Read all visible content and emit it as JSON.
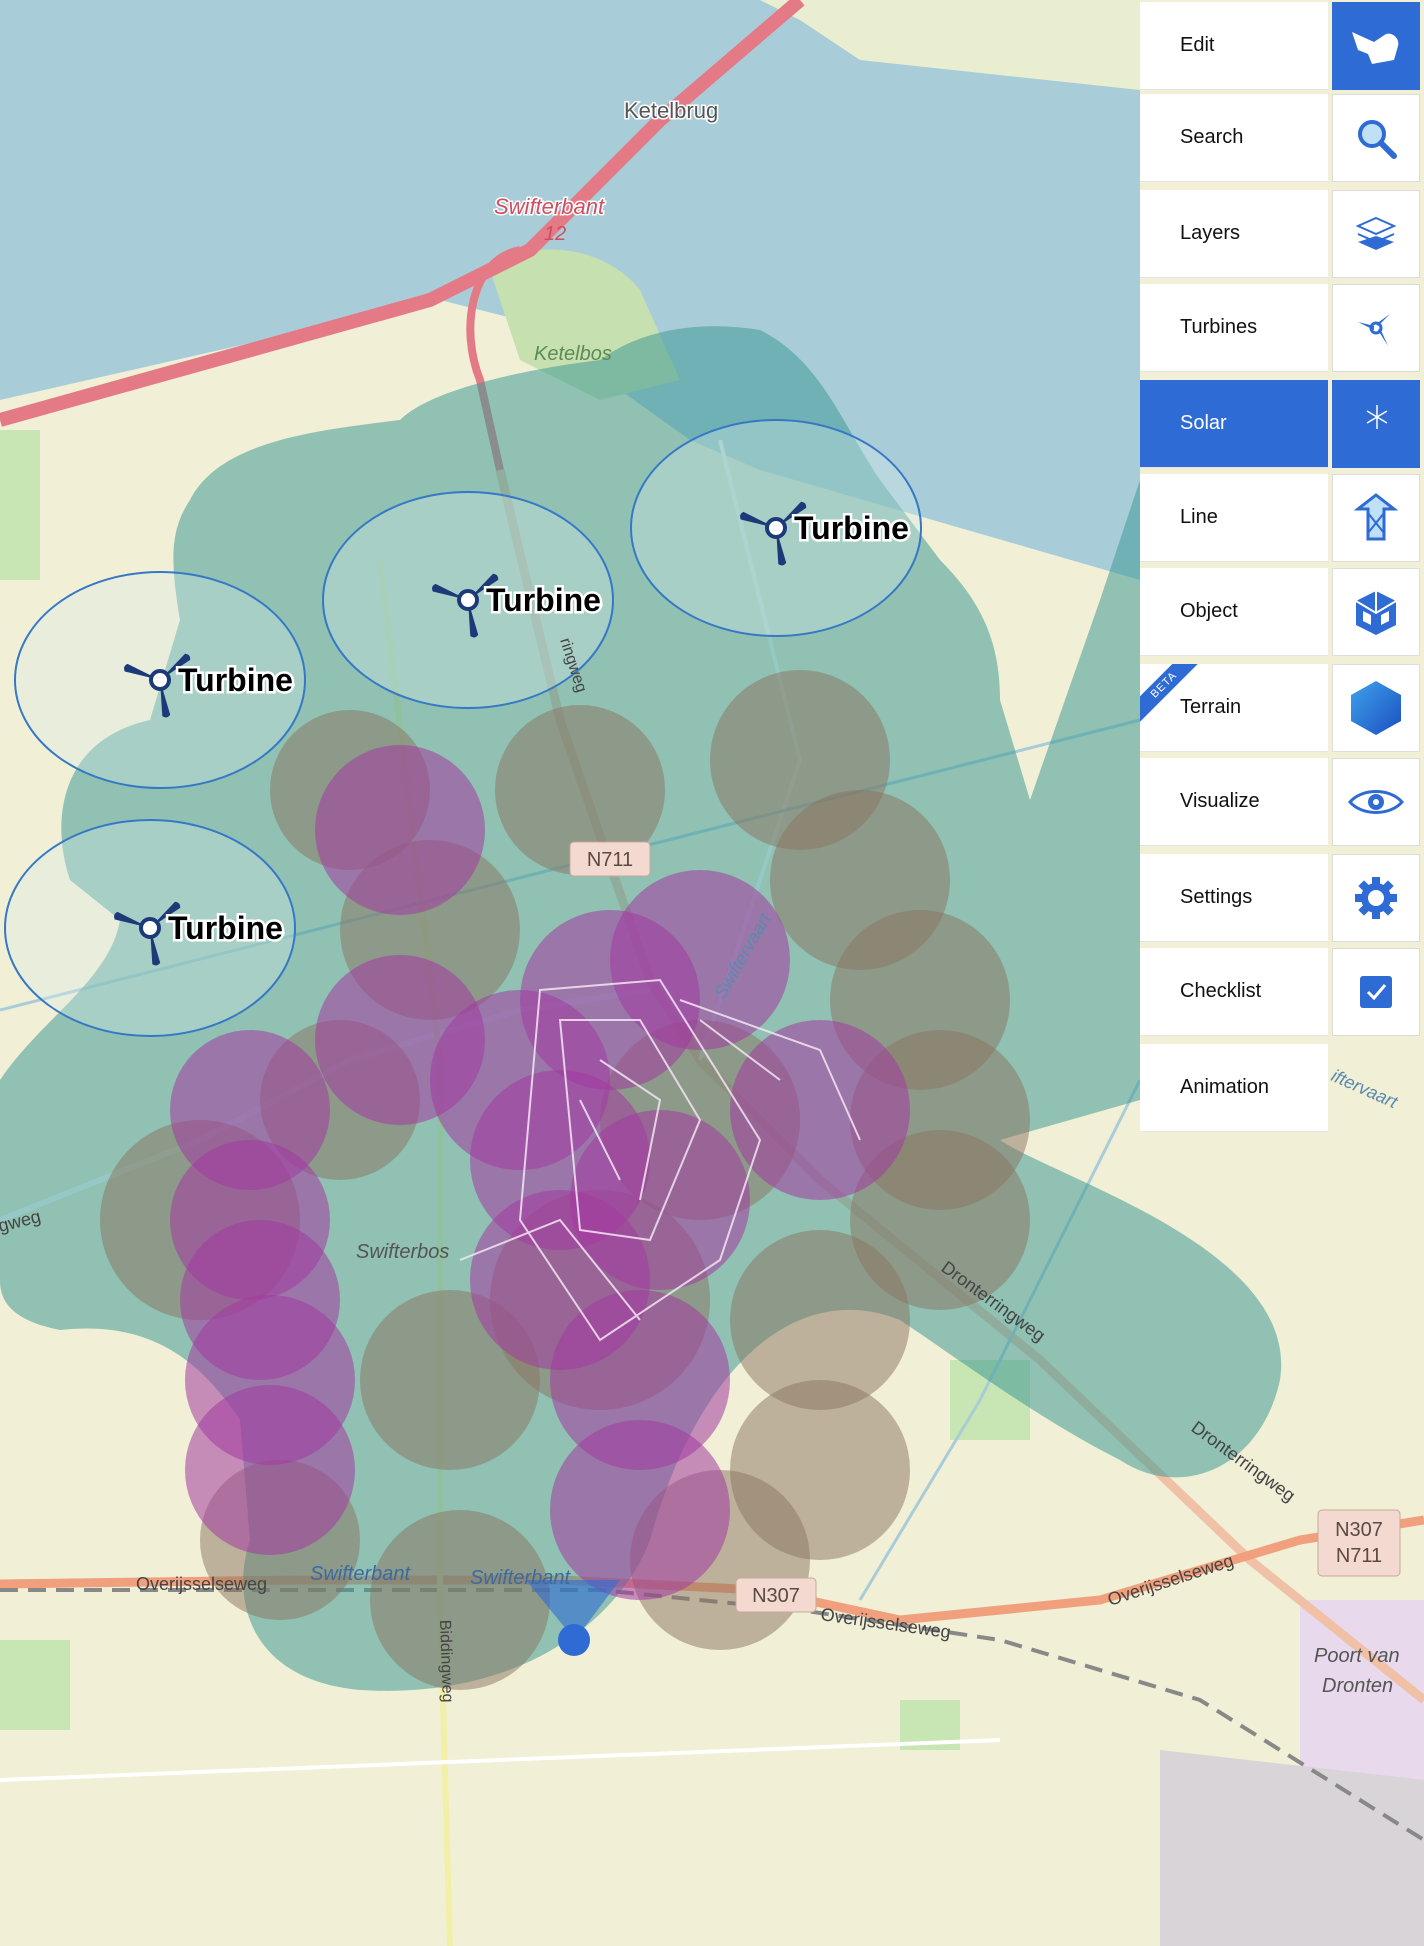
{
  "map": {
    "place_labels": {
      "ketelbrug": "Ketelbrug",
      "swifterbant_exit": "Swifterbant",
      "exit_number": "12",
      "ketelbos": "Ketelbos",
      "swifterbos": "Swifterbos",
      "swifterbant_station_1": "Swifterbant",
      "swifterbant_station_2": "Swifterbant",
      "poort_van_1": "Poort van",
      "poort_van_2": "Dronten"
    },
    "road_labels": {
      "n711": "N711",
      "n307": "N307",
      "n307_box_1": "N307",
      "n307_box_2": "N711",
      "overijsselseweg_1": "Overijsselseweg",
      "overijsselseweg_2": "Overijsselseweg",
      "overijsselseweg_3": "Overijsselseweg",
      "dronterringweg_1": "Dronterringweg",
      "dronterringweg_2": "Dronterringweg",
      "biddingweg": "Biddingweg",
      "ringweg": "gweg",
      "swiftervaart_1": "Swiftervaart",
      "swiftervaart_2": "iftervaart",
      "ringweg_n": "ringweg"
    },
    "turbines": [
      {
        "label": "Turbine"
      },
      {
        "label": "Turbine"
      },
      {
        "label": "Turbine"
      },
      {
        "label": "Turbine"
      }
    ],
    "colors": {
      "water": "#a8cdd9",
      "land": "#f1efd6",
      "buffer_teal": "#3f9a96",
      "buffer_brown": "#8a7360",
      "buffer_purple": "#a33aa0",
      "highway": "#e47a86",
      "secondary_road": "#f0a07c",
      "turbine_icon": "#1c3a78",
      "accent": "#2f6bd4"
    }
  },
  "menu": {
    "items": [
      {
        "label": "Edit",
        "icon": "hand-pointer-icon"
      },
      {
        "label": "Search",
        "icon": "search-icon"
      },
      {
        "label": "Layers",
        "icon": "layers-icon"
      },
      {
        "label": "Turbines",
        "icon": "turbine-icon"
      },
      {
        "label": "Solar",
        "icon": "solar-panel-icon"
      },
      {
        "label": "Line",
        "icon": "pylon-line-icon"
      },
      {
        "label": "Object",
        "icon": "cube-object-icon"
      },
      {
        "label": "Terrain",
        "icon": "hexagon-terrain-icon",
        "badge": "BETA"
      },
      {
        "label": "Visualize",
        "icon": "eye-visualize-icon"
      },
      {
        "label": "Settings",
        "icon": "gear-icon"
      },
      {
        "label": "Checklist",
        "icon": "checkbox-icon"
      },
      {
        "label": "Animation",
        "icon": ""
      }
    ],
    "active_label": "Solar",
    "active_icon": "Edit"
  }
}
